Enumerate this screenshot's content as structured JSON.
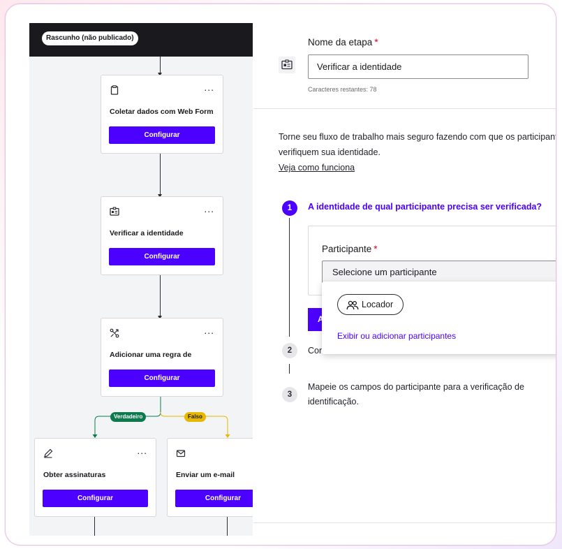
{
  "canvas": {
    "draft_badge": "Rascunho (não publicado)",
    "nodes": [
      {
        "title": "Coletar dados com Web Form",
        "button": "Configurar",
        "icon": "clipboard-icon"
      },
      {
        "title": "Verificar a identidade",
        "button": "Configurar",
        "icon": "id-card-icon"
      },
      {
        "title": "Adicionar uma regra de",
        "button": "Configurar",
        "icon": "branch-rule-icon"
      },
      {
        "title": "Obter assinaturas",
        "button": "Configurar",
        "icon": "pen-icon"
      },
      {
        "title": "Enviar um e-mail",
        "button": "Configurar",
        "icon": "envelope-icon"
      }
    ],
    "node_menu": "...",
    "branch_true": "Verdadeiro",
    "branch_false": "Falso"
  },
  "panel": {
    "step_name_label": "Nome da etapa",
    "required_mark": "*",
    "step_name_value": "Verificar a identidade",
    "chars_remaining": "Caracteres restantes: 78",
    "intro_line1": "Torne seu fluxo de trabalho mais seguro fazendo com que os participantes",
    "intro_line2": "verifiquem sua identidade.",
    "how_link": "Veja como funciona",
    "steps": [
      {
        "number": "1",
        "title": "A identidade de qual participante precisa ser verificada?"
      },
      {
        "number": "2",
        "title": "Con"
      },
      {
        "number": "3",
        "title": "Mapeie os campos do participante para a verificação de identificação."
      }
    ],
    "participant_label": "Participante",
    "participant_placeholder": "Selecione um participante",
    "hidden_button": "A",
    "dropdown": {
      "option": "Locador",
      "add_link": "Exibir ou adicionar participantes"
    }
  },
  "colors": {
    "accent": "#4c00ff",
    "dark": "#19191e",
    "true_branch": "#0d7a4e",
    "false_branch": "#e6b800",
    "required": "#d6002b"
  }
}
